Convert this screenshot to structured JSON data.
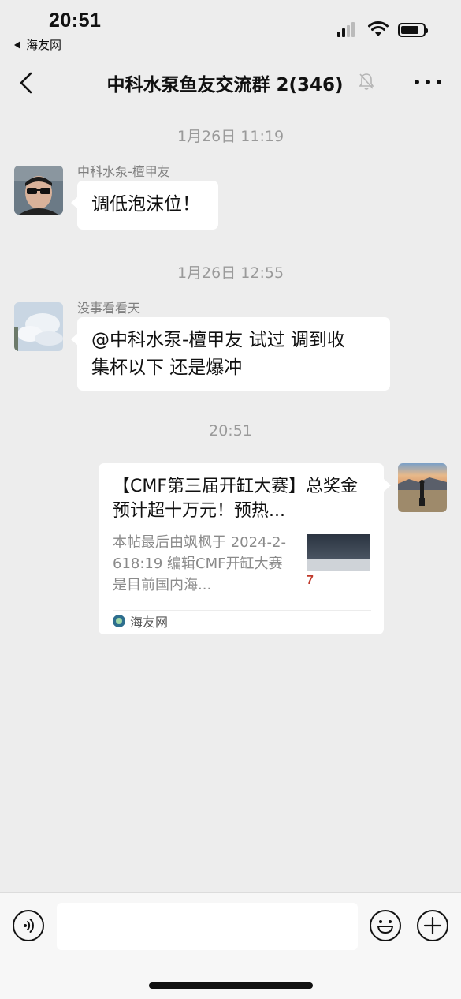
{
  "status_bar": {
    "time": "20:51",
    "back_app_label": "海友网"
  },
  "nav": {
    "title": "中科水泵鱼友交流群 2(346)"
  },
  "messages": [
    {
      "timestamp": "1月26日 11:19",
      "sender": "中科水泵-檀甲友",
      "text": "调低泡沫位！"
    },
    {
      "timestamp": "1月26日 12:55",
      "sender": "没事看看天",
      "text_line1": "@中科水泵-檀甲友 试过 调到收",
      "text_line2": "集杯以下 还是爆冲"
    },
    {
      "timestamp": "20:51"
    }
  ],
  "link_card": {
    "title": "【CMF第三届开缸大赛】总奖金预计超十万元！预热...",
    "desc": "本帖最后由飒枫于 2024-2-618:19 编辑CMF开缸大赛是目前国内海...",
    "thumb_text": "7",
    "source": "海友网"
  },
  "input": {
    "placeholder": ""
  }
}
